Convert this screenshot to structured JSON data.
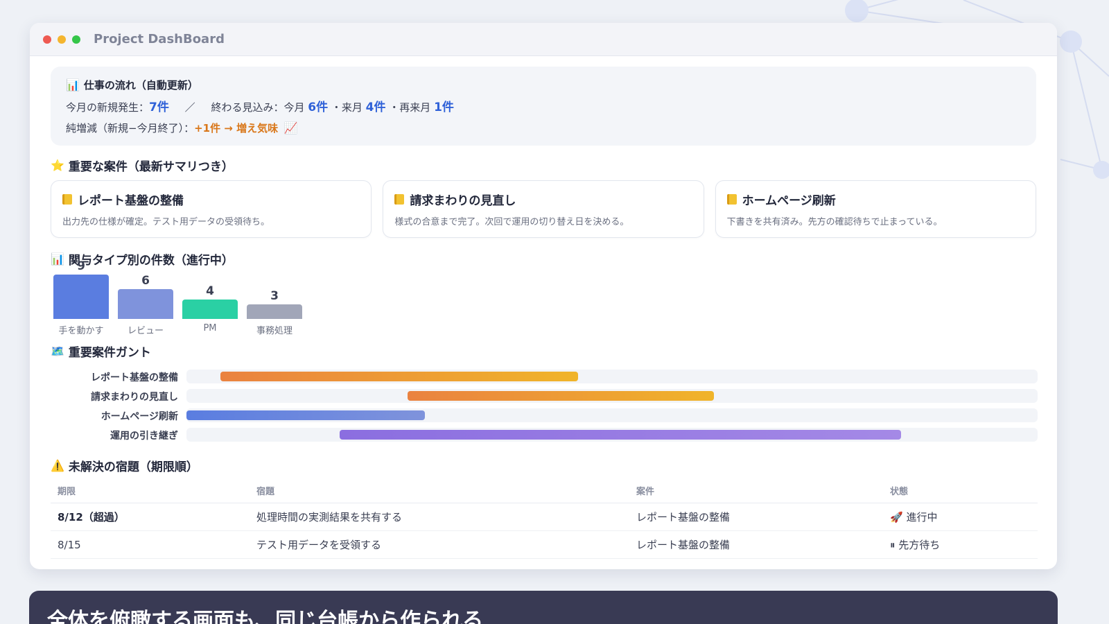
{
  "window": {
    "title": "Project DashBoard"
  },
  "flow": {
    "title": "仕事の流れ（自動更新）",
    "line1_prefix": "今月の新規発生：",
    "new_count": "7件",
    "separator": "／",
    "forecast_label": "終わる見込み：今月",
    "this_month": "6件",
    "next_label": "・来月",
    "next_month": "4件",
    "after_label": "・再来月",
    "after_month": "1件",
    "line2_prefix": "純増減（新規−今月終了）：",
    "net": "+1件 → 増え気味"
  },
  "important": {
    "title": "重要な案件（最新サマリつき）",
    "cards": [
      {
        "title": "レポート基盤の整備",
        "desc": "出力先の仕様が確定。テスト用データの受領待ち。"
      },
      {
        "title": "請求まわりの見直し",
        "desc": "様式の合意まで完了。次回で運用の切り替え日を決める。"
      },
      {
        "title": "ホームページ刷新",
        "desc": "下書きを共有済み。先方の確認待ちで止まっている。"
      }
    ]
  },
  "by_type": {
    "title": "関与タイプ別の件数（進行中）"
  },
  "chart_data": {
    "type": "bar",
    "categories": [
      "手を動かす",
      "レビュー",
      "PM",
      "事務処理"
    ],
    "values": [
      9,
      6,
      4,
      3
    ],
    "colors": [
      "#5a7de0",
      "#7f93dc",
      "#2ad0a4",
      "#a1a6b8"
    ]
  },
  "gantt": {
    "title": "重要案件ガント",
    "rows": [
      {
        "label": "レポート基盤の整備",
        "start": 0.04,
        "end": 0.46,
        "color_from": "#ea8240",
        "color_to": "#f0b42a"
      },
      {
        "label": "請求まわりの見直し",
        "start": 0.26,
        "end": 0.62,
        "color_from": "#ea8240",
        "color_to": "#f0b42a"
      },
      {
        "label": "ホームページ刷新",
        "start": 0.0,
        "end": 0.28,
        "color_from": "#5a7de0",
        "color_to": "#7f93dc"
      },
      {
        "label": "運用の引き継ぎ",
        "start": 0.18,
        "end": 0.84,
        "color_from": "#8b6ee0",
        "color_to": "#a489e6"
      }
    ]
  },
  "tasks": {
    "title": "未解決の宿題（期限順）",
    "headers": [
      "期限",
      "宿題",
      "案件",
      "状態"
    ],
    "rows": [
      {
        "due": "8/12（超過）",
        "task": "処理時間の実測結果を共有する",
        "project": "レポート基盤の整備",
        "status": "🚀 進行中"
      },
      {
        "due": "8/15",
        "task": "テスト用データを受領する",
        "project": "レポート基盤の整備",
        "status": "⏸ 先方待ち"
      }
    ]
  },
  "footer": {
    "text": "全体を俯瞰する画面も、同じ台帳から作られる"
  }
}
